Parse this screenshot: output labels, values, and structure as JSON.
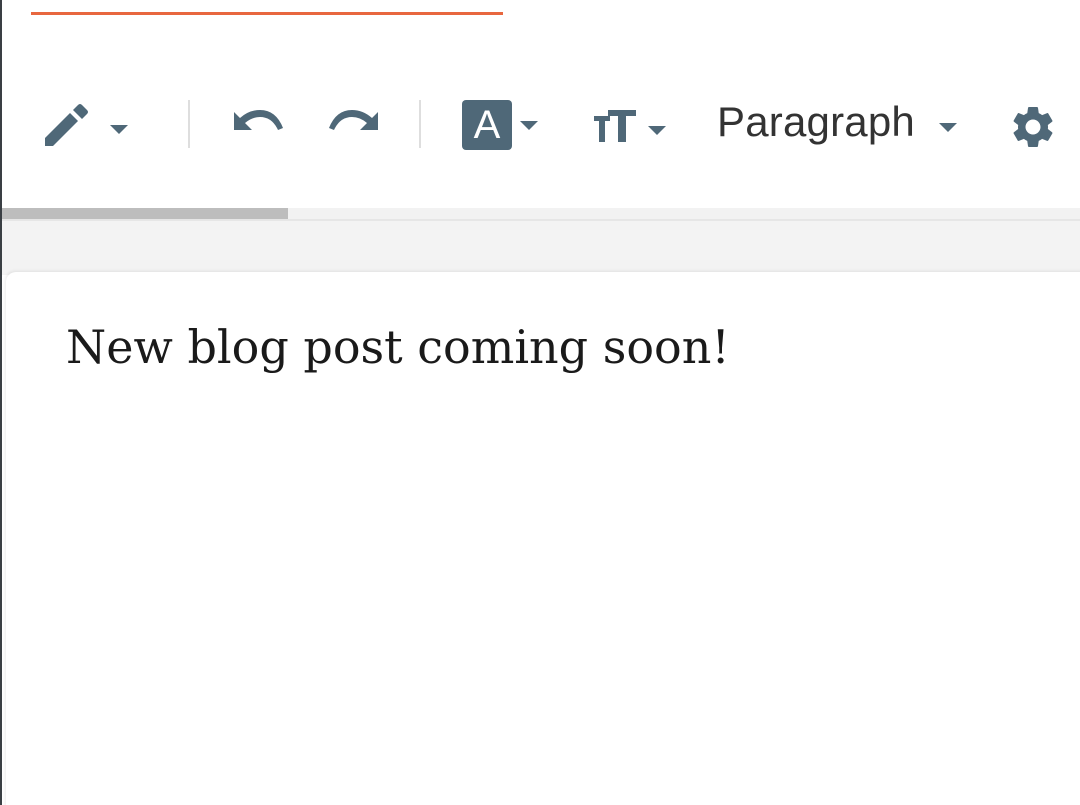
{
  "toolbar": {
    "items": [
      {
        "id": "pencil",
        "icon": "pencil-icon",
        "has_dropdown": true
      },
      {
        "id": "undo",
        "icon": "undo-icon"
      },
      {
        "id": "redo",
        "icon": "redo-icon"
      },
      {
        "id": "text-color",
        "icon": "text-color-icon",
        "glyph": "A",
        "has_dropdown": true
      },
      {
        "id": "text-size",
        "icon": "text-size-icon",
        "has_dropdown": true
      },
      {
        "id": "block-format",
        "label": "Paragraph",
        "has_dropdown": true
      },
      {
        "id": "settings",
        "icon": "gear-icon"
      }
    ],
    "text_color_glyph": "A",
    "paragraph_label": "Paragraph",
    "icon_color": "#4f6878"
  },
  "progress": {
    "fraction": 0.265
  },
  "editor": {
    "content": "New blog post coming soon!"
  },
  "colors": {
    "accent": "#e8673f",
    "icon": "#4f6878",
    "text": "#1a1a1a",
    "progress_fill": "#bdbdbd",
    "background_band": "#f3f3f3"
  }
}
